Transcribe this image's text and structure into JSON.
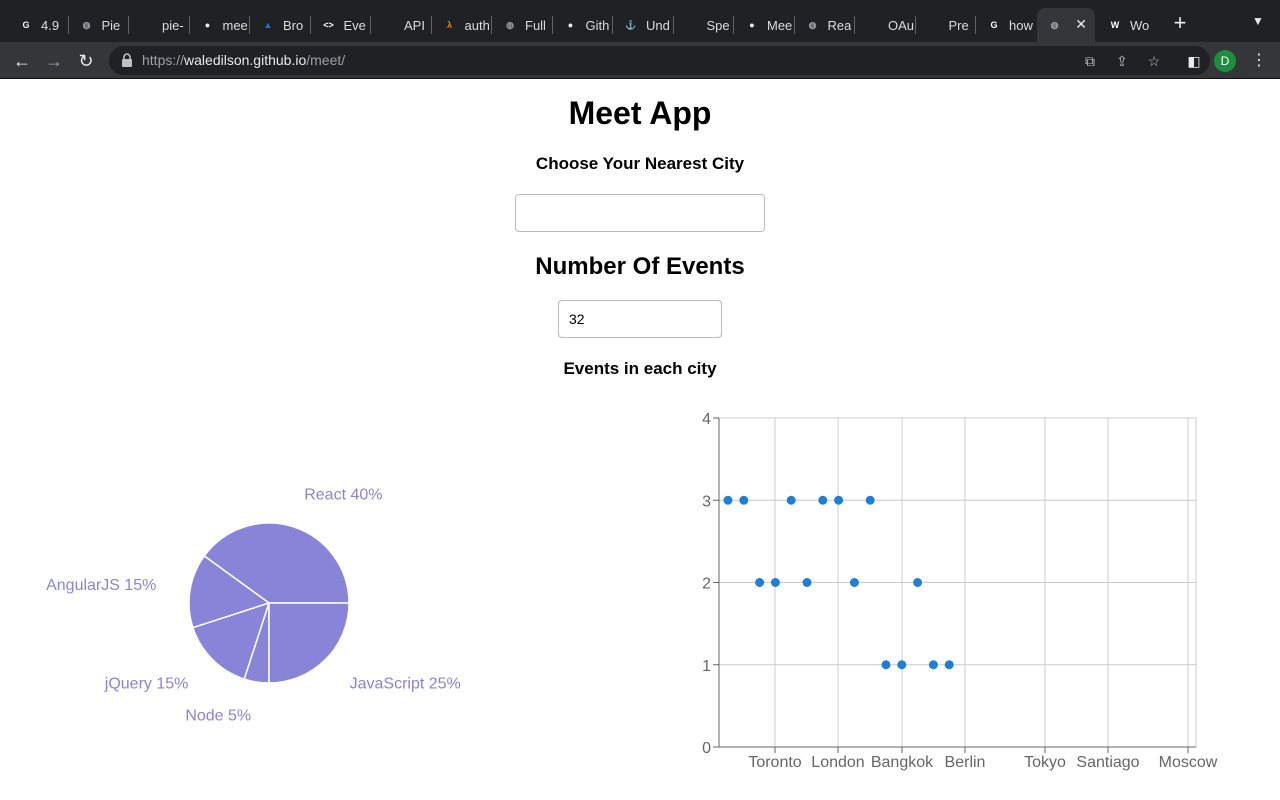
{
  "browser": {
    "tabs": [
      {
        "title": "4.9",
        "icon": "gatsby-icon",
        "color": "#f1f3f4",
        "glyph": "G"
      },
      {
        "title": "Pie",
        "icon": "globe-icon",
        "color": "#9aa0a6",
        "glyph": "◍"
      },
      {
        "title": "pie-",
        "icon": "square-icon",
        "color": "#202124",
        "glyph": "☐"
      },
      {
        "title": "mee",
        "icon": "github-icon",
        "color": "#f1f3f4",
        "glyph": "●"
      },
      {
        "title": "Bro",
        "icon": "triangle-icon",
        "color": "#1a73e8",
        "glyph": "▲"
      },
      {
        "title": "Eve",
        "icon": "code-icon",
        "color": "#ffffff",
        "glyph": "<>"
      },
      {
        "title": "API",
        "icon": "api-icon",
        "color": "#202124",
        "glyph": "API"
      },
      {
        "title": "auth",
        "icon": "lambda-icon",
        "color": "#f57c00",
        "glyph": "λ"
      },
      {
        "title": "Full",
        "icon": "globe-icon",
        "color": "#9aa0a6",
        "glyph": "◍"
      },
      {
        "title": "Gith",
        "icon": "github-icon",
        "color": "#f1f3f4",
        "glyph": "●"
      },
      {
        "title": "Und",
        "icon": "anchor-icon",
        "color": "#202124",
        "glyph": "⚓"
      },
      {
        "title": "Spe",
        "icon": "medium-icon",
        "color": "#202124",
        "glyph": "M"
      },
      {
        "title": "Mee",
        "icon": "github-icon",
        "color": "#f1f3f4",
        "glyph": "●"
      },
      {
        "title": "Rea",
        "icon": "globe-icon",
        "color": "#9aa0a6",
        "glyph": "◍"
      },
      {
        "title": "OAu",
        "icon": "gmail-icon",
        "color": "#202124",
        "glyph": "M"
      },
      {
        "title": "Pre",
        "icon": "api-icon",
        "color": "#202124",
        "glyph": "API"
      },
      {
        "title": "how",
        "icon": "google-icon",
        "color": "#ffffff",
        "glyph": "G"
      },
      {
        "title": "",
        "icon": "globe-icon",
        "color": "#9aa0a6",
        "glyph": "◍",
        "active": true
      },
      {
        "title": "Wo",
        "icon": "wordpress-icon",
        "color": "#ffffff",
        "glyph": "W"
      }
    ],
    "url_prefix": "https://",
    "url_host": "waledilson.github.io",
    "url_path": "/meet/",
    "profile_initial": "D"
  },
  "app": {
    "title": "Meet App",
    "city_label": "Choose Your Nearest City",
    "city_value": "",
    "events_heading": "Number Of Events",
    "events_value": "32",
    "chart_heading": "Events in each city"
  },
  "chart_data": [
    {
      "type": "pie",
      "slices": [
        {
          "label": "React",
          "percent": 40,
          "display": "React 40%"
        },
        {
          "label": "AngularJS",
          "percent": 15,
          "display": "AngularJS 15%"
        },
        {
          "label": "jQuery",
          "percent": 15,
          "display": "jQuery 15%"
        },
        {
          "label": "Node",
          "percent": 5,
          "display": "Node 5%"
        },
        {
          "label": "JavaScript",
          "percent": 25,
          "display": "JavaScript 25%"
        }
      ],
      "color": "#8884d8"
    },
    {
      "type": "scatter",
      "x_categories": [
        "Toronto",
        "London",
        "Bangkok",
        "Berlin",
        "Tokyo",
        "Santiago",
        "Moscow"
      ],
      "ylim": [
        0,
        4
      ],
      "y_ticks": [
        0,
        1,
        2,
        3,
        4
      ],
      "grid": true,
      "point_color": "#1f7fd6",
      "points": [
        {
          "x": 0.2,
          "y": 3
        },
        {
          "x": 0.45,
          "y": 3
        },
        {
          "x": 0.7,
          "y": 2
        },
        {
          "x": 0.95,
          "y": 2
        },
        {
          "x": 1.2,
          "y": 3
        },
        {
          "x": 1.45,
          "y": 2
        },
        {
          "x": 1.7,
          "y": 3
        },
        {
          "x": 1.95,
          "y": 3
        },
        {
          "x": 2.2,
          "y": 2
        },
        {
          "x": 2.45,
          "y": 3
        },
        {
          "x": 2.7,
          "y": 1
        },
        {
          "x": 2.95,
          "y": 1
        },
        {
          "x": 3.2,
          "y": 2
        },
        {
          "x": 3.45,
          "y": 1
        },
        {
          "x": 3.7,
          "y": 1
        }
      ]
    }
  ]
}
